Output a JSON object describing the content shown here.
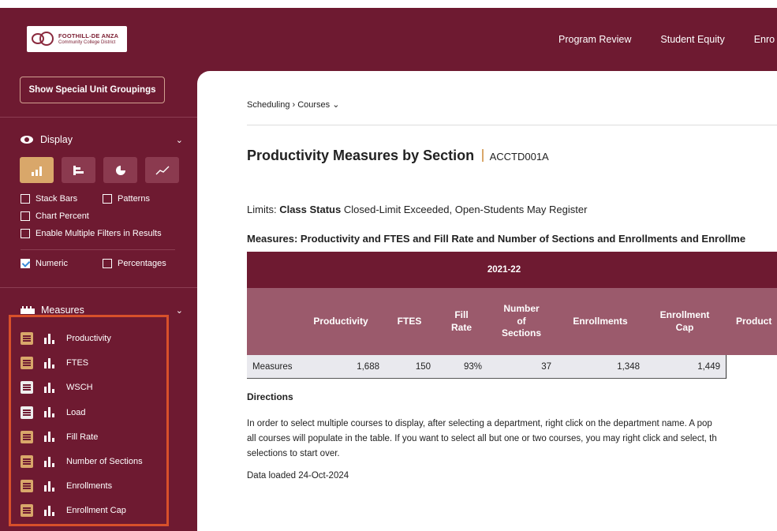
{
  "header": {
    "logo_line1": "FOOTHILL-DE ANZA",
    "logo_line2": "Community College District",
    "nav": [
      "Program Review",
      "Student Equity",
      "Enro"
    ]
  },
  "sidebar": {
    "special_button": "Show Special Unit Groupings",
    "display_label": "Display",
    "chart_types": [
      "bar-chart-icon",
      "horizontal-bar-icon",
      "pie-chart-icon",
      "line-chart-icon"
    ],
    "checks": {
      "stack_bars": "Stack Bars",
      "patterns": "Patterns",
      "chart_percent": "Chart Percent",
      "multiple_filters": "Enable Multiple Filters in Results",
      "numeric": "Numeric",
      "percentages": "Percentages"
    },
    "measures_label": "Measures",
    "measures": [
      {
        "label": "Productivity",
        "selected": true
      },
      {
        "label": "FTES",
        "selected": true
      },
      {
        "label": "WSCH",
        "selected": false
      },
      {
        "label": "Load",
        "selected": false
      },
      {
        "label": "Fill Rate",
        "selected": true
      },
      {
        "label": "Number of Sections",
        "selected": true
      },
      {
        "label": "Enrollments",
        "selected": true
      },
      {
        "label": "Enrollment Cap",
        "selected": true
      }
    ]
  },
  "main": {
    "breadcrumb": "Scheduling › Courses ⌄",
    "title": "Productivity Measures by Section",
    "title_code": "ACCTD001A",
    "limits_label": "Limits:",
    "limits_key": "Class Status",
    "limits_value": "Closed-Limit Exceeded, Open-Students May Register",
    "measures_line": "Measures: Productivity and FTES and Fill Rate and Number of Sections and Enrollments and Enrollme",
    "table": {
      "year": "2021-22",
      "columns": [
        "Productivity",
        "FTES",
        "Fill Rate",
        "Number of Sections",
        "Enrollments",
        "Enrollment Cap",
        "Product"
      ],
      "row_label": "Measures",
      "values": [
        "1,688",
        "150",
        "93%",
        "37",
        "1,348",
        "1,449"
      ]
    },
    "directions_title": "Directions",
    "directions": [
      "In order to select multiple courses to display, after selecting a department, right click on the department name. A pop",
      "all courses will populate in the table. If you want to select all but one or two courses, you may right click and select, th",
      "selections to start over."
    ],
    "loaded": "Data loaded 24-Oct-2024"
  }
}
